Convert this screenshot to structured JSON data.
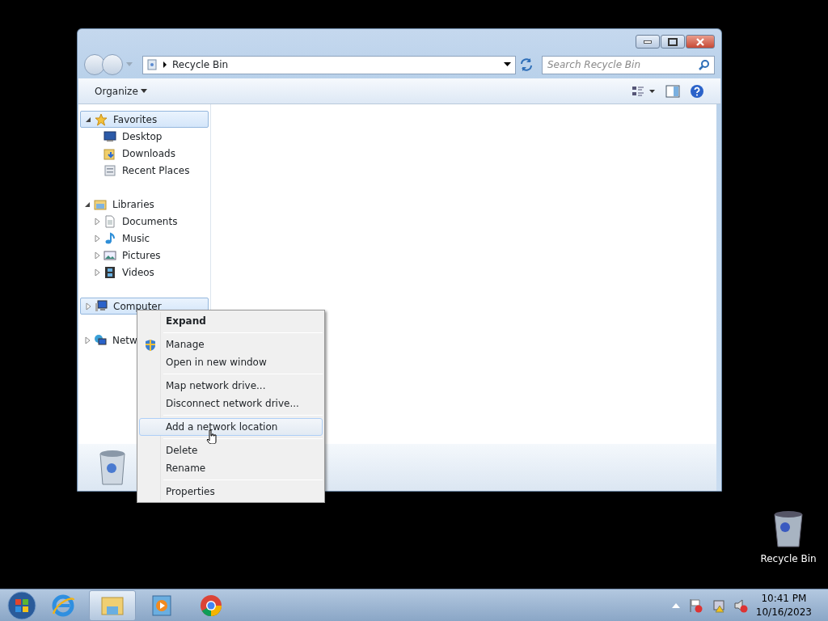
{
  "window": {
    "address": "Recycle Bin",
    "search": {
      "placeholder": "Search Recycle Bin"
    },
    "toolbar": {
      "organize": "Organize"
    }
  },
  "nav": [
    {
      "label": "Favorites",
      "expanded": true,
      "highlighted": true,
      "children": [
        {
          "label": "Desktop",
          "highlighted": false
        },
        {
          "label": "Downloads",
          "highlighted": false
        },
        {
          "label": "Recent Places",
          "highlighted": false
        }
      ]
    },
    {
      "label": "Libraries",
      "expanded": true,
      "highlighted": false,
      "children": [
        {
          "label": "Documents",
          "expanded": false,
          "highlighted": false
        },
        {
          "label": "Music",
          "expanded": false,
          "highlighted": false
        },
        {
          "label": "Pictures",
          "expanded": false,
          "highlighted": false
        },
        {
          "label": "Videos",
          "expanded": false,
          "highlighted": false
        }
      ]
    },
    {
      "label": "Computer",
      "expanded": false,
      "highlighted": true
    },
    {
      "label": "Netw",
      "expanded": false,
      "highlighted": false
    }
  ],
  "context_menu": [
    {
      "kind": "item",
      "label": "Expand",
      "default": true,
      "shield": false,
      "highlighted": false
    },
    {
      "kind": "separator"
    },
    {
      "kind": "item",
      "label": "Manage",
      "default": false,
      "shield": true,
      "highlighted": false
    },
    {
      "kind": "item",
      "label": "Open in new window",
      "default": false,
      "shield": false,
      "highlighted": false
    },
    {
      "kind": "separator"
    },
    {
      "kind": "item",
      "label": "Map network drive...",
      "default": false,
      "shield": false,
      "highlighted": false
    },
    {
      "kind": "item",
      "label": "Disconnect network drive...",
      "default": false,
      "shield": false,
      "highlighted": false
    },
    {
      "kind": "separator"
    },
    {
      "kind": "item",
      "label": "Add a network location",
      "default": false,
      "shield": false,
      "highlighted": true
    },
    {
      "kind": "separator"
    },
    {
      "kind": "item",
      "label": "Delete",
      "default": false,
      "shield": false,
      "highlighted": false
    },
    {
      "kind": "item",
      "label": "Rename",
      "default": false,
      "shield": false,
      "highlighted": false
    },
    {
      "kind": "separator"
    },
    {
      "kind": "item",
      "label": "Properties",
      "default": false,
      "shield": false,
      "highlighted": false
    }
  ],
  "desktop_icons": [
    {
      "label": "Recycle Bin"
    }
  ],
  "taskbar": {
    "apps": [
      {
        "active": false
      },
      {
        "active": true
      },
      {
        "active": false
      },
      {
        "active": false
      }
    ],
    "clock": {
      "time": "10:41 PM",
      "date": "10/16/2023"
    }
  }
}
